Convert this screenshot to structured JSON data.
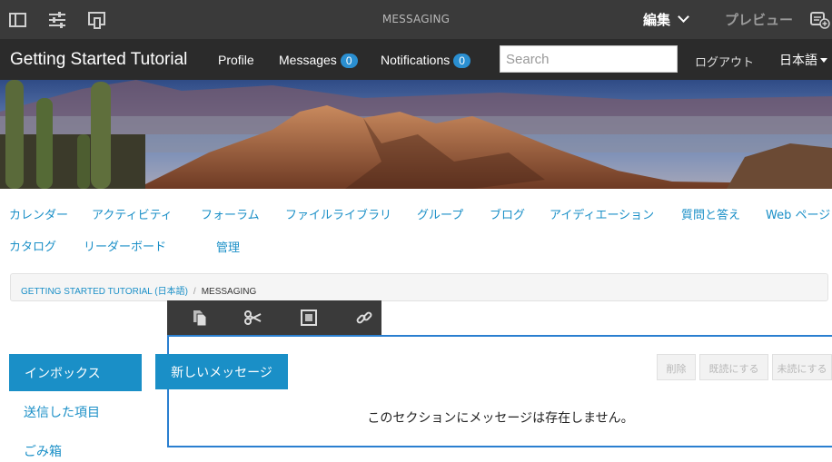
{
  "editor": {
    "title": "MESSAGING",
    "mode_label": "編集",
    "preview_label": "プレビュー",
    "icons": [
      "side-panel-icon",
      "properties-icon",
      "emulator-icon",
      "annotations-icon"
    ]
  },
  "header": {
    "site_title": "Getting Started Tutorial",
    "profile": "Profile",
    "messages": "Messages",
    "messages_count": "0",
    "notifications": "Notifications",
    "notifications_count": "0",
    "search_placeholder": "Search",
    "logout": "ログアウト",
    "language": "日本語"
  },
  "nav": {
    "row1": [
      "カレンダー",
      "アクティビティ",
      "フォーラム",
      "ファイルライブラリ",
      "グループ",
      "ブログ",
      "アイディエーション",
      "質問と答え",
      "Web ページ"
    ],
    "row2": [
      "カタログ",
      "リーダーボード",
      "管理"
    ]
  },
  "breadcrumb": {
    "parent": "GETTING STARTED TUTORIAL (日本語)",
    "separator": "/",
    "current": "MESSAGING"
  },
  "component_toolbar": [
    "copy-icon",
    "cut-icon",
    "group-icon",
    "link-icon"
  ],
  "sidebar": {
    "items": [
      {
        "label": "インボックス",
        "active": true
      },
      {
        "label": "送信した項目",
        "active": false
      },
      {
        "label": "ごみ箱",
        "active": false
      }
    ]
  },
  "messages": {
    "new_message": "新しいメッセージ",
    "delete": "削除",
    "mark_read": "既読にする",
    "mark_unread": "未読にする",
    "empty": "このセクションにメッセージは存在しません。"
  },
  "colors": {
    "accent": "#1a8fc7",
    "editor_bar": "#3a3a3a",
    "header": "#2b2b2b",
    "badge": "#2a8fd1",
    "outline": "#2a7fd0"
  }
}
